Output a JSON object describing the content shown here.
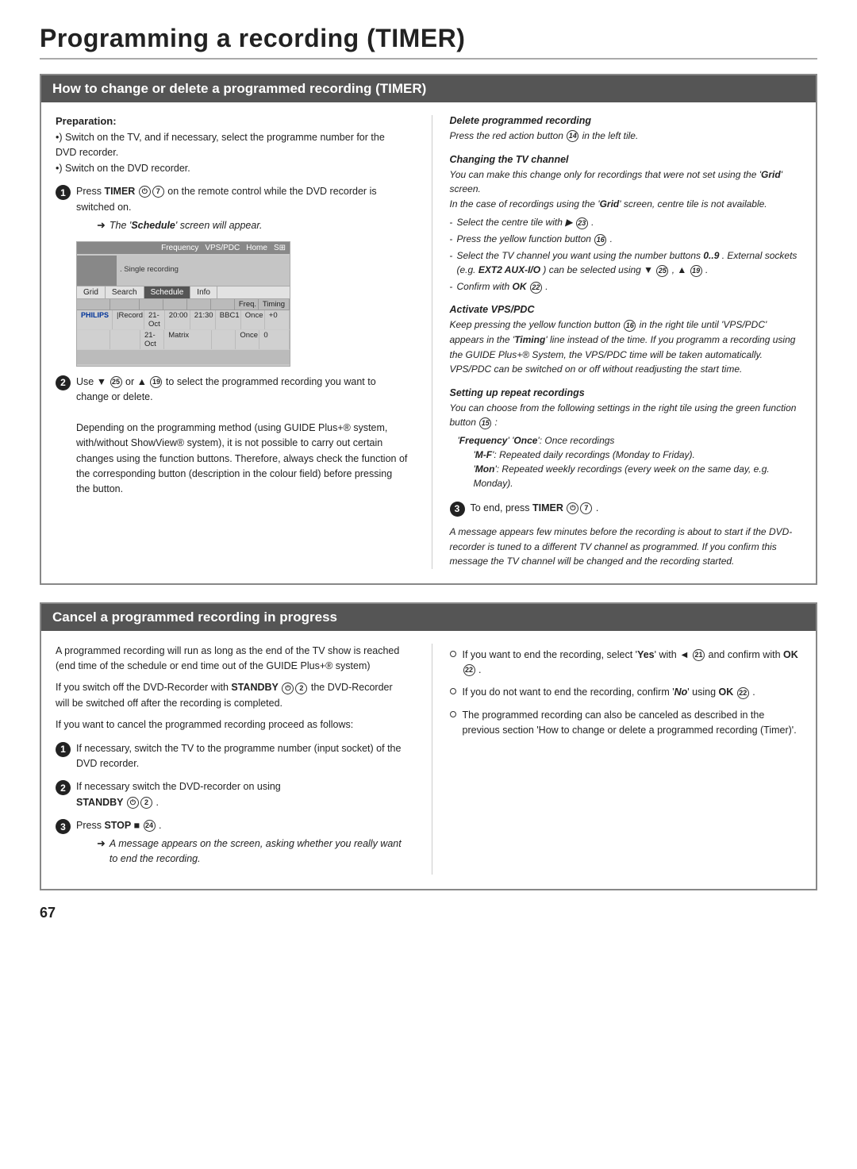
{
  "page": {
    "title": "Programming a recording (TIMER)",
    "page_number": "67"
  },
  "section1": {
    "title": "How to change or delete a programmed recording (TIMER)",
    "left": {
      "preparation_label": "Preparation:",
      "preparation_lines": [
        "•) Switch on the TV, and if necessary, select the programme number for the DVD recorder.",
        "•) Switch on the DVD recorder."
      ],
      "step1_text": "Press  TIMER",
      "step1_circle1": "⏻",
      "step1_num1": "7",
      "step1_suffix": " on the remote control while the DVD recorder is switched on.",
      "step1_arrow": "The 'Schedule' screen will appear.",
      "step2_prefix": "Use ▼",
      "step2_num1": "25",
      "step2_mid": " or ▲",
      "step2_num2": "19",
      "step2_suffix": " to select the programmed recording you want to change or delete.",
      "step2_detail": "Depending on the programming method (using GUIDE Plus+® system, with/without ShowView® system), it is not possible to carry out certain changes using the function buttons. Therefore, always check the function of the corresponding button (description in the colour field) before pressing the button."
    },
    "screen": {
      "top_bar": [
        "Frequency",
        "VPS/PDC",
        "Home",
        "S⊞"
      ],
      "single_recording": ". Single recording",
      "menu_items": [
        "Grid",
        "Search",
        "Schedule",
        "Info"
      ],
      "data_headers": [
        "",
        "",
        "",
        "",
        "Freq.",
        "Timing"
      ],
      "data_rows": [
        [
          "PHILIPS",
          "|Record",
          "21-Oct",
          "20:00",
          "21:30",
          "BBC1",
          "Once",
          "+0"
        ],
        [
          "",
          "",
          "21-Oct",
          "Matrix",
          "",
          "",
          "Once",
          "0"
        ]
      ]
    },
    "right": {
      "delete_title": "Delete programmed recording",
      "delete_text": "Press the red action button ⑭ in the left tile.",
      "changing_tv_title": "Changing the TV channel",
      "changing_tv_text1": "You can make this change only for recordings that were not set using the 'Grid' screen.",
      "changing_tv_text2": "In the case of recordings using the 'Grid' screen, centre tile is not available.",
      "changing_tv_items": [
        "Select the centre tile with ▶ ㉓ .",
        "Press the yellow function button ⑯ .",
        "Select the TV channel you want using the number buttons  0..9 . External sockets (e.g. EXT2 AUX-I/O ) can be selected using ▼ ㉕ , ▲ ⑲ .",
        "Confirm with  OK ㉒ ."
      ],
      "activate_vps_title": "Activate VPS/PDC",
      "activate_vps_text": "Keep pressing the yellow function button ⑯ in the right tile until 'VPS/PDC' appears in the 'Timing' line instead of the time. If you programm a recording using the GUIDE Plus+® System, the VPS/PDC time will be taken automatically. VPS/PDC can be switched on or off without readjusting the start time.",
      "setting_title": "Setting up repeat recordings",
      "setting_text1": "You can choose from the following settings in the right tile using the green function button ⑮ :",
      "setting_items": [
        "'Frequency' 'Once': Once recordings",
        "'M-F': Repeated daily recordings (Monday to Friday).",
        "'Mon': Repeated weekly recordings (every week on the same day, e.g. Monday)."
      ],
      "step3_text": "To end, press  TIMER",
      "step3_nums": [
        "⏻",
        "7"
      ],
      "step3_suffix": " .",
      "italic_note": "A message appears few minutes before the recording is about to start if the DVD-recorder is tuned to a different TV channel as programmed. If you confirm this message the TV channel will be changed and the recording started."
    }
  },
  "section2": {
    "title": "Cancel a programmed recording in progress",
    "left": {
      "para1": "A programmed recording will run as long as the end of the TV show is reached (end time of the schedule or end time out of the GUIDE Plus+® system)",
      "para2_prefix": "If you switch off the DVD-Recorder with  STANDBY",
      "para2_num": "2",
      "para2_suffix": " the DVD-Recorder will be switched off after the recording is completed.",
      "para3": "If you want to cancel the programmed recording proceed as follows:",
      "step1_text": "If necessary, switch the TV to the programme number (input socket) of the DVD recorder.",
      "step2_prefix": "If necessary switch the DVD-recorder on using",
      "step2_bold": "STANDBY",
      "step2_num": "2",
      "step2_suffix": " .",
      "step3_prefix": "Press  STOP ■",
      "step3_num": "24",
      "step3_suffix": " .",
      "step3_arrow": "A message appears on the screen, asking whether you really want to end the recording."
    },
    "right": {
      "bullet1_prefix": "If you want to end the recording, select '",
      "bullet1_yes": "Yes",
      "bullet1_mid": "' with ◄",
      "bullet1_num": "21",
      "bullet1_suffix": " and confirm with  OK ㉒ .",
      "bullet2_prefix": "If you do not want to end the recording, confirm '",
      "bullet2_no": "No",
      "bullet2_mid": "' using",
      "bullet2_ok": "OK ㉒",
      "bullet2_suffix": " .",
      "bullet3": "The programmed recording can also be canceled as described in the previous section 'How to change or delete a programmed recording (Timer)'."
    }
  }
}
